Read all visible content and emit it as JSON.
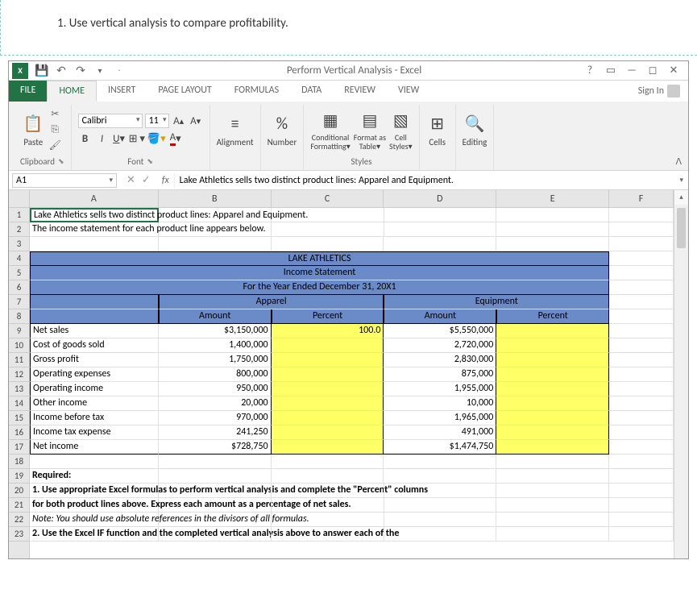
{
  "question": "1. Use vertical analysis to compare profitability.",
  "window": {
    "title": "Perform Vertical Analysis - Excel",
    "signin": "Sign In"
  },
  "tabs": {
    "file": "FILE",
    "home": "HOME",
    "insert": "INSERT",
    "pagelayout": "PAGE LAYOUT",
    "formulas": "FORMULAS",
    "data": "DATA",
    "review": "REVIEW",
    "view": "VIEW"
  },
  "ribbon": {
    "clipboard": {
      "label": "Clipboard",
      "paste": "Paste"
    },
    "font": {
      "label": "Font",
      "name": "Calibri",
      "size": "11"
    },
    "alignment": {
      "label": "Alignment"
    },
    "number": {
      "label": "Number",
      "pct": "%"
    },
    "styles": {
      "label": "Styles",
      "cond": "Conditional Formatting",
      "fmt": "Format as Table",
      "cell": "Cell Styles"
    },
    "cells": {
      "label": "Cells"
    },
    "editing": {
      "label": "Editing"
    }
  },
  "namebox": "A1",
  "formulabar": "Lake Athletics sells two distinct product lines:  Apparel and Equipment.",
  "cols": [
    "A",
    "B",
    "C",
    "D",
    "E",
    "F"
  ],
  "sheet": {
    "r1": "Lake Athletics sells two distinct product lines:  Apparel and Equipment.",
    "r2": "The income statement for each product line appears below.",
    "r4": "LAKE ATHLETICS",
    "r5": "Income Statement",
    "r6": "For the Year Ended December 31, 20X1",
    "r7a": "Apparel",
    "r7b": "Equipment",
    "r8a": "Amount",
    "r8b": "Percent",
    "r8c": "Amount",
    "r8d": "Percent",
    "rows": [
      {
        "label": "Net sales",
        "b": "$3,150,000",
        "c": "100.0",
        "d": "$5,550,000"
      },
      {
        "label": "Cost of goods sold",
        "b": "1,400,000",
        "c": "",
        "d": "2,720,000"
      },
      {
        "label": "Gross profit",
        "b": "1,750,000",
        "c": "",
        "d": "2,830,000"
      },
      {
        "label": "Operating expenses",
        "b": "800,000",
        "c": "",
        "d": "875,000"
      },
      {
        "label": "Operating income",
        "b": "950,000",
        "c": "",
        "d": "1,955,000"
      },
      {
        "label": "Other income",
        "b": "20,000",
        "c": "",
        "d": "10,000"
      },
      {
        "label": "Income before tax",
        "b": "970,000",
        "c": "",
        "d": "1,965,000"
      },
      {
        "label": "Income tax expense",
        "b": "241,250",
        "c": "",
        "d": "491,000"
      },
      {
        "label": "Net income",
        "b": "$728,750",
        "c": "",
        "d": "$1,474,750"
      }
    ],
    "r19": "Required:",
    "r20": "1. Use appropriate Excel formulas to perform vertical analysis and complete the \"Percent\" columns",
    "r21": "    for both product lines above.  Express each amount as a percentage of net sales.",
    "r22": "Note:  You should use absolute references in the divisors of all formulas.",
    "r23": "2.  Use the Excel IF function and the completed vertical analysis above to answer each of the"
  }
}
